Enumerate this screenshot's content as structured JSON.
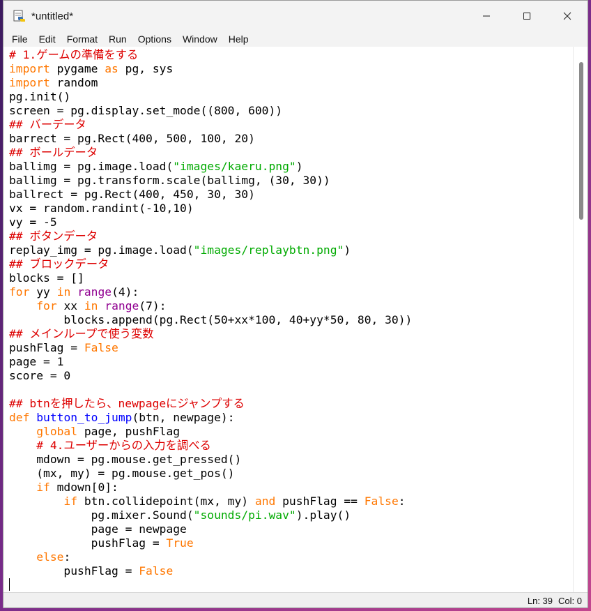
{
  "window": {
    "title": "*untitled*",
    "controls": {
      "minimize": "—",
      "maximize": "☐",
      "close": "✕"
    }
  },
  "menu": [
    "File",
    "Edit",
    "Format",
    "Run",
    "Options",
    "Window",
    "Help"
  ],
  "colors": {
    "keyword": "#ff7700",
    "comment": "#dd0000",
    "string": "#00aa00",
    "builtin": "#900090",
    "definition": "#0000ff"
  },
  "code_lines": [
    [
      [
        "cm",
        "# 1.ゲームの準備をする"
      ]
    ],
    [
      [
        "kw",
        "import"
      ],
      [
        "",
        " pygame "
      ],
      [
        "kw",
        "as"
      ],
      [
        "",
        " pg, sys"
      ]
    ],
    [
      [
        "kw",
        "import"
      ],
      [
        "",
        " random"
      ]
    ],
    [
      [
        "",
        "pg.init()"
      ]
    ],
    [
      [
        "",
        "screen = pg.display.set_mode((800, 600))"
      ]
    ],
    [
      [
        "cm",
        "## バーデータ"
      ]
    ],
    [
      [
        "",
        "barrect = pg.Rect(400, 500, 100, 20)"
      ]
    ],
    [
      [
        "cm",
        "## ボールデータ"
      ]
    ],
    [
      [
        "",
        "ballimg = pg.image.load("
      ],
      [
        "st",
        "\"images/kaeru.png\""
      ],
      [
        "",
        ")"
      ]
    ],
    [
      [
        "",
        "ballimg = pg.transform.scale(ballimg, (30, 30))"
      ]
    ],
    [
      [
        "",
        "ballrect = pg.Rect(400, 450, 30, 30)"
      ]
    ],
    [
      [
        "",
        "vx = random.randint(-10,10)"
      ]
    ],
    [
      [
        "",
        "vy = -5"
      ]
    ],
    [
      [
        "cm",
        "## ボタンデータ"
      ]
    ],
    [
      [
        "",
        "replay_img = pg.image.load("
      ],
      [
        "st",
        "\"images/replaybtn.png\""
      ],
      [
        "",
        ")"
      ]
    ],
    [
      [
        "cm",
        "## ブロックデータ"
      ]
    ],
    [
      [
        "",
        "blocks = []"
      ]
    ],
    [
      [
        "kw",
        "for"
      ],
      [
        "",
        " yy "
      ],
      [
        "kw",
        "in"
      ],
      [
        "",
        " "
      ],
      [
        "bi",
        "range"
      ],
      [
        "",
        "(4):"
      ]
    ],
    [
      [
        "",
        "    "
      ],
      [
        "kw",
        "for"
      ],
      [
        "",
        " xx "
      ],
      [
        "kw",
        "in"
      ],
      [
        "",
        " "
      ],
      [
        "bi",
        "range"
      ],
      [
        "",
        "(7):"
      ]
    ],
    [
      [
        "",
        "        blocks.append(pg.Rect(50+xx*100, 40+yy*50, 80, 30))"
      ]
    ],
    [
      [
        "cm",
        "## メインループで使う変数"
      ]
    ],
    [
      [
        "",
        "pushFlag = "
      ],
      [
        "kw",
        "False"
      ]
    ],
    [
      [
        "",
        "page = 1"
      ]
    ],
    [
      [
        "",
        "score = 0"
      ]
    ],
    [
      [
        "",
        ""
      ]
    ],
    [
      [
        "cm",
        "## btnを押したら、newpageにジャンプする"
      ]
    ],
    [
      [
        "kw",
        "def"
      ],
      [
        "",
        " "
      ],
      [
        "df",
        "button_to_jump"
      ],
      [
        "",
        "(btn, newpage):"
      ]
    ],
    [
      [
        "",
        "    "
      ],
      [
        "kw",
        "global"
      ],
      [
        "",
        " page, pushFlag"
      ]
    ],
    [
      [
        "",
        "    "
      ],
      [
        "cm",
        "# 4.ユーザーからの入力を調べる"
      ]
    ],
    [
      [
        "",
        "    mdown = pg.mouse.get_pressed()"
      ]
    ],
    [
      [
        "",
        "    (mx, my) = pg.mouse.get_pos()"
      ]
    ],
    [
      [
        "",
        "    "
      ],
      [
        "kw",
        "if"
      ],
      [
        "",
        " mdown[0]:"
      ]
    ],
    [
      [
        "",
        "        "
      ],
      [
        "kw",
        "if"
      ],
      [
        "",
        " btn.collidepoint(mx, my) "
      ],
      [
        "kw",
        "and"
      ],
      [
        "",
        " pushFlag == "
      ],
      [
        "kw",
        "False"
      ],
      [
        "",
        ":"
      ]
    ],
    [
      [
        "",
        "            pg.mixer.Sound("
      ],
      [
        "st",
        "\"sounds/pi.wav\""
      ],
      [
        "",
        ").play()"
      ]
    ],
    [
      [
        "",
        "            page = newpage"
      ]
    ],
    [
      [
        "",
        "            pushFlag = "
      ],
      [
        "kw",
        "True"
      ]
    ],
    [
      [
        "",
        "    "
      ],
      [
        "kw",
        "else"
      ],
      [
        "",
        ":"
      ]
    ],
    [
      [
        "",
        "        pushFlag = "
      ],
      [
        "kw",
        "False"
      ]
    ],
    [
      [
        "",
        ""
      ]
    ]
  ],
  "status": {
    "line": "Ln: 39",
    "col": "Col: 0"
  }
}
